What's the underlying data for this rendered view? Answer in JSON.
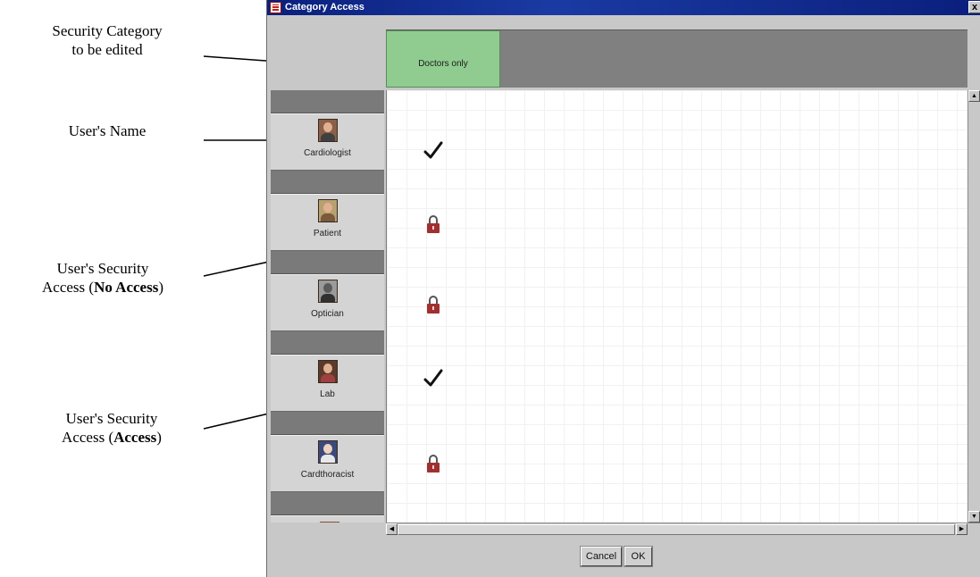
{
  "annotations": {
    "category": {
      "line1": "Security Category",
      "line2": "to be edited"
    },
    "user_name": "User's Name",
    "no_access": {
      "line1": "User's Security",
      "line2_prefix": "Access (",
      "bold": "No Access",
      "suffix": ")"
    },
    "access": {
      "line1": "User's Security",
      "line2_prefix": "Access (",
      "bold": "Access",
      "suffix": ")"
    }
  },
  "window": {
    "title": "Category Access",
    "close_glyph": "x",
    "category_tab": "Doctors only",
    "users": [
      {
        "name": "Cardiologist",
        "icon": "cardiologist-avatar",
        "access": "access"
      },
      {
        "name": "Patient",
        "icon": "patient-avatar",
        "access": "no-access"
      },
      {
        "name": "Optician",
        "icon": "optician-avatar",
        "access": "no-access"
      },
      {
        "name": "Lab",
        "icon": "lab-avatar",
        "access": "access"
      },
      {
        "name": "Cardthoracist",
        "icon": "cardthoracist-avatar",
        "access": "no-access"
      }
    ],
    "buttons": {
      "cancel": "Cancel",
      "ok": "OK"
    },
    "colors": {
      "category_tab": "#90cc90",
      "titlebar": "#0a1f7c",
      "lock": "#a03030"
    }
  }
}
